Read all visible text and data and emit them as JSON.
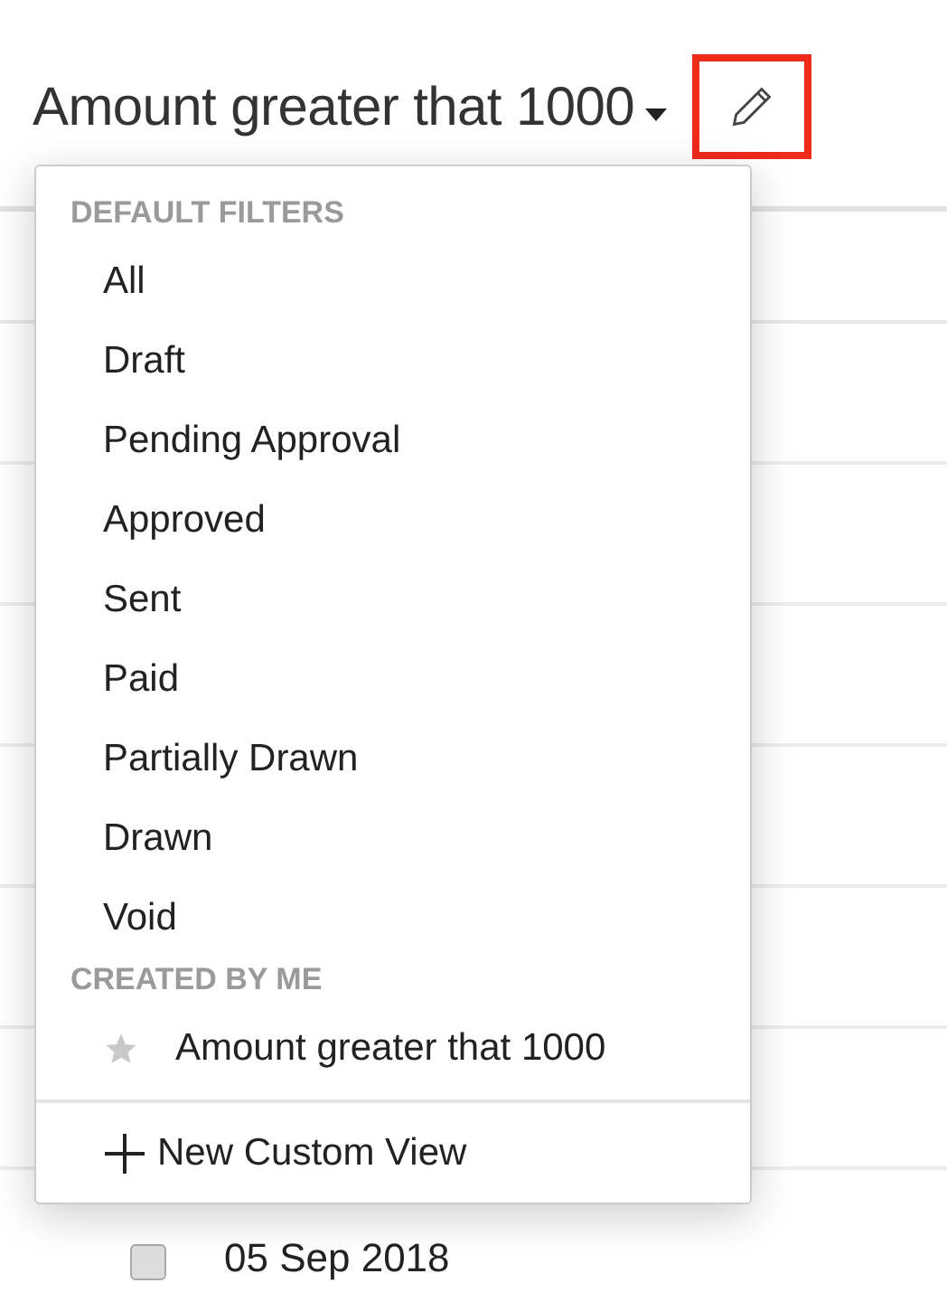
{
  "header": {
    "title": "Amount greater that 1000",
    "edit_button": {
      "highlighted": true
    }
  },
  "menu": {
    "sections": [
      {
        "heading": "DEFAULT FILTERS",
        "items": [
          {
            "label": "All",
            "starred": false
          },
          {
            "label": "Draft",
            "starred": false
          },
          {
            "label": "Pending Approval",
            "starred": false
          },
          {
            "label": "Approved",
            "starred": false
          },
          {
            "label": "Sent",
            "starred": false
          },
          {
            "label": "Paid",
            "starred": false
          },
          {
            "label": "Partially Drawn",
            "starred": false
          },
          {
            "label": "Drawn",
            "starred": false
          },
          {
            "label": "Void",
            "starred": false
          }
        ]
      },
      {
        "heading": "CREATED BY ME",
        "items": [
          {
            "label": "Amount greater that 1000",
            "starred": true
          }
        ]
      }
    ],
    "action": "New Custom View"
  },
  "rows": [
    {
      "date": "05 Sep 2018",
      "checked": false
    }
  ]
}
